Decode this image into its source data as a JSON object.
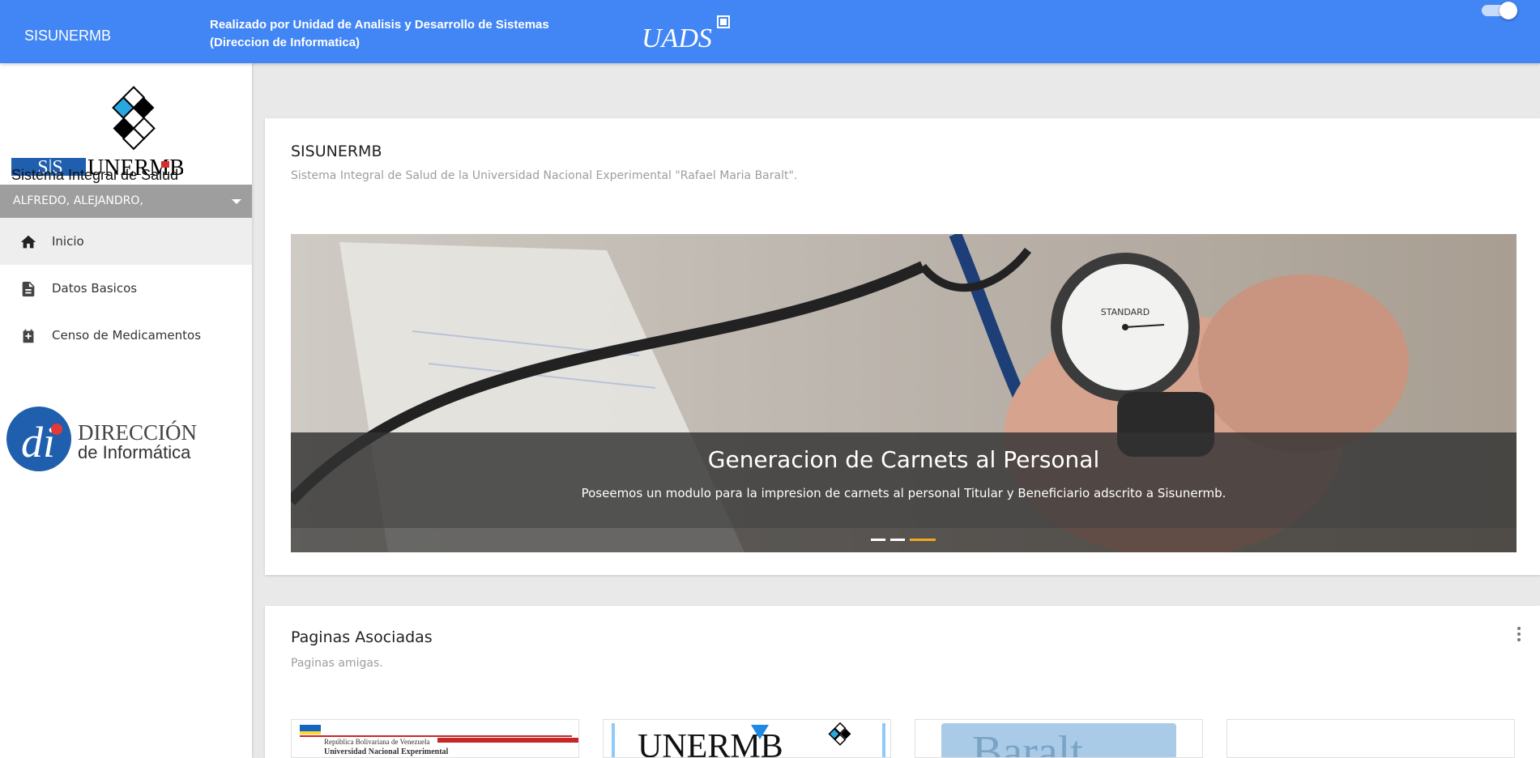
{
  "header": {
    "brand": "SISUNERMB",
    "credit_line1": "Realizado por Unidad de Analisis y Desarrollo de Sistemas",
    "credit_line2": "(Direccion de Informatica)",
    "logo_text": "UADS",
    "toggle_state": "on"
  },
  "sidebar": {
    "logo_text": "SIS UNERMB",
    "logo_caption": "Sistema Integral de Salud",
    "user": "ALFREDO, ALEJANDRO,",
    "items": [
      {
        "label": "Inicio",
        "icon": "home-icon"
      },
      {
        "label": "Datos Basicos",
        "icon": "document-icon"
      },
      {
        "label": "Censo de Medicamentos",
        "icon": "medical-kit-icon"
      }
    ],
    "di_logo_line1": "DIRECCIÓN",
    "di_logo_line2": "de Informática"
  },
  "main": {
    "card1": {
      "title": "SISUNERMB",
      "subtitle": "Sistema Integral de Salud de la Universidad Nacional Experimental \"Rafael Maria Baralt\".",
      "carousel": {
        "slide_title": "Generacion de Carnets al Personal",
        "slide_text": "Poseemos un modulo para la impresion de carnets al personal Titular y Beneficiario adscrito a Sisunermb.",
        "slide_count": 3,
        "active_slide": 3
      }
    },
    "card2": {
      "title": "Paginas Asociadas",
      "subtitle": "Paginas amigas.",
      "thumb_texts": {
        "unermb_banner_line1": "República Bolivariana de Venezuela",
        "unermb_banner_line2": "Universidad Nacional Experimental",
        "unermb_logo": "UNERMB",
        "baralt": "Baralt"
      }
    }
  },
  "colors": {
    "primary": "#4285f4",
    "sidebar_user_bar": "#9e9e9e",
    "indicator_active": "#f5a623",
    "page_bg": "#e9e9e9"
  }
}
